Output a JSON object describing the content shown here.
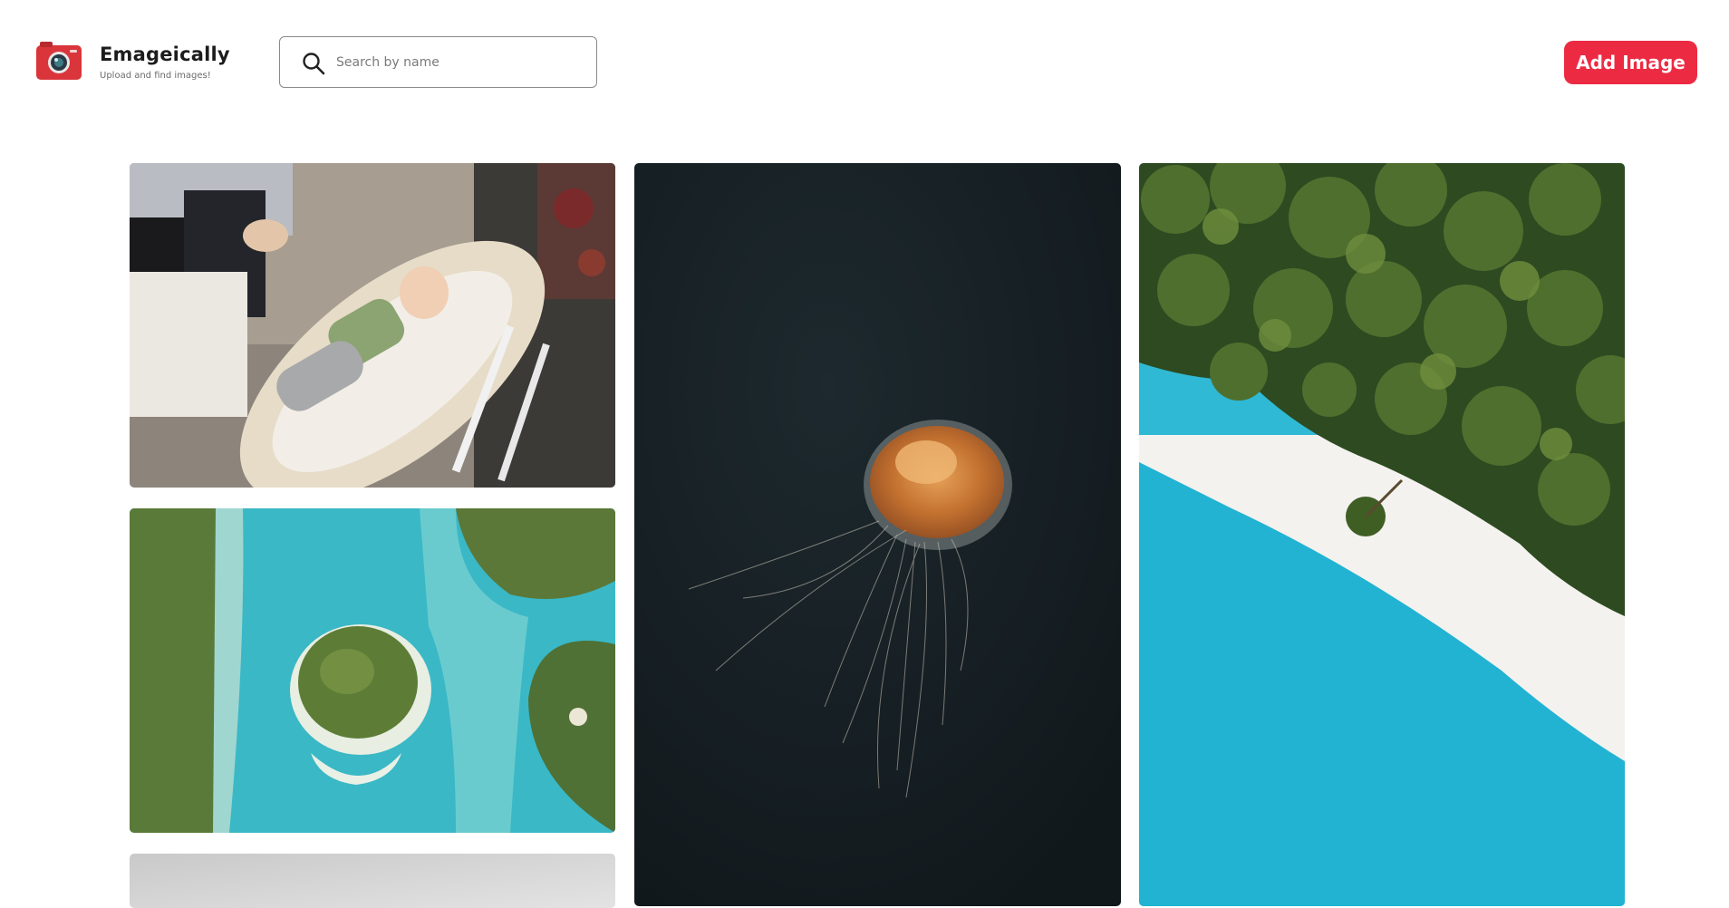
{
  "app": {
    "name": "Emageically",
    "tagline": "Upload and find images!"
  },
  "search": {
    "placeholder": "Search by name",
    "value": ""
  },
  "toolbar": {
    "add_label": "Add Image"
  },
  "colors": {
    "accent": "#ec2b43",
    "logo": "#d9353a",
    "text": "#1c1c1c"
  },
  "gallery": {
    "images": [
      {
        "subject": "baby in wicker bassinet",
        "icon": "photo-baby"
      },
      {
        "subject": "aerial tropical islands",
        "icon": "photo-islands"
      },
      {
        "subject": "grey photo",
        "icon": "photo-grey"
      },
      {
        "subject": "jellyfish in dark water",
        "icon": "photo-jellyfish"
      },
      {
        "subject": "aerial beach with palm trees",
        "icon": "photo-beach"
      }
    ]
  }
}
